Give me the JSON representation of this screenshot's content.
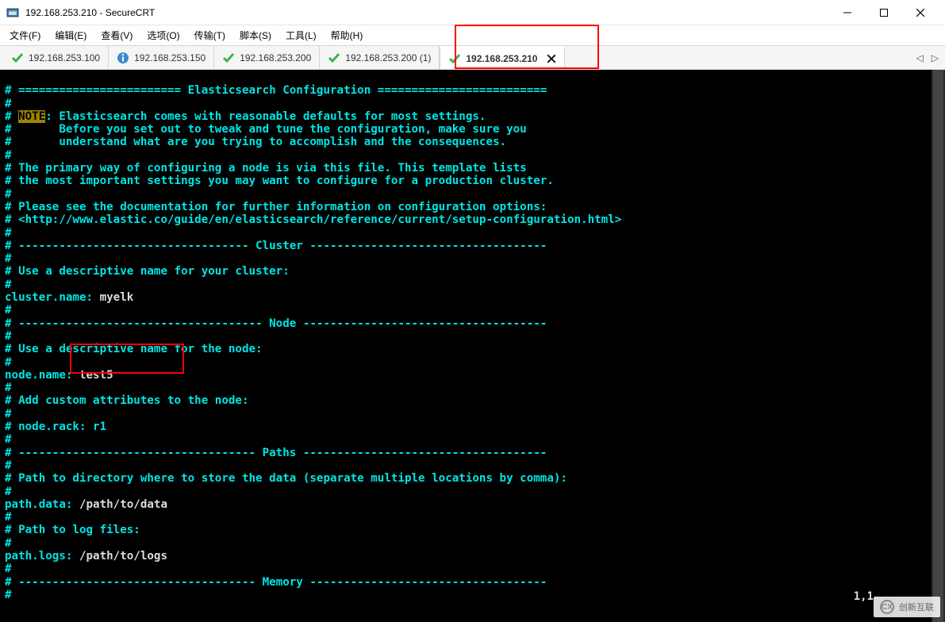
{
  "window": {
    "title": "192.168.253.210 - SecureCRT"
  },
  "menu": {
    "items": [
      "文件(F)",
      "编辑(E)",
      "查看(V)",
      "选项(O)",
      "传输(T)",
      "脚本(S)",
      "工具(L)",
      "帮助(H)"
    ]
  },
  "tabs": {
    "items": [
      {
        "label": "192.168.253.100",
        "icon": "check",
        "active": false
      },
      {
        "label": "192.168.253.150",
        "icon": "info",
        "active": false
      },
      {
        "label": "192.168.253.200",
        "icon": "check",
        "active": false
      },
      {
        "label": "192.168.253.200 (1)",
        "icon": "check",
        "active": false
      },
      {
        "label": "192.168.253.210",
        "icon": "check",
        "active": true
      }
    ]
  },
  "terminal": {
    "header": "# ======================== Elasticsearch Configuration =========================",
    "note_label": "NOTE",
    "note_line": ": Elasticsearch comes with reasonable defaults for most settings.",
    "note_line2": "#       Before you set out to tweak and tune the configuration, make sure you",
    "note_line3": "#       understand what are you trying to accomplish and the consequences.",
    "primary1": "# The primary way of configuring a node is via this file. This template lists",
    "primary2": "# the most important settings you may want to configure for a production cluster.",
    "doc1": "# Please see the documentation for further information on configuration options:",
    "doc2": "# <http://www.elastic.co/guide/en/elasticsearch/reference/current/setup-configuration.html>",
    "sec_cluster": "# ---------------------------------- Cluster -----------------------------------",
    "cluster_desc": "# Use a descriptive name for your cluster:",
    "cluster_key": "cluster.name:",
    "cluster_val": " myelk",
    "sec_node": "# ------------------------------------ Node ------------------------------------",
    "node_desc": "# Use a descriptive name for the node:",
    "node_key": "node.name:",
    "node_val": " test5",
    "attr_desc": "# Add custom attributes to the node:",
    "attr_line": "# node.rack: r1",
    "sec_paths": "# ----------------------------------- Paths ------------------------------------",
    "paths_desc": "# Path to directory where to store the data (separate multiple locations by comma):",
    "path_data_key": "path.data:",
    "path_data_val": " /path/to/data",
    "logs_desc": "# Path to log files:",
    "path_logs_key": "path.logs:",
    "path_logs_val": " /path/to/logs",
    "sec_memory": "# ----------------------------------- Memory -----------------------------------"
  },
  "status": {
    "position": "1,1"
  },
  "watermark": {
    "text": "创新互联"
  }
}
